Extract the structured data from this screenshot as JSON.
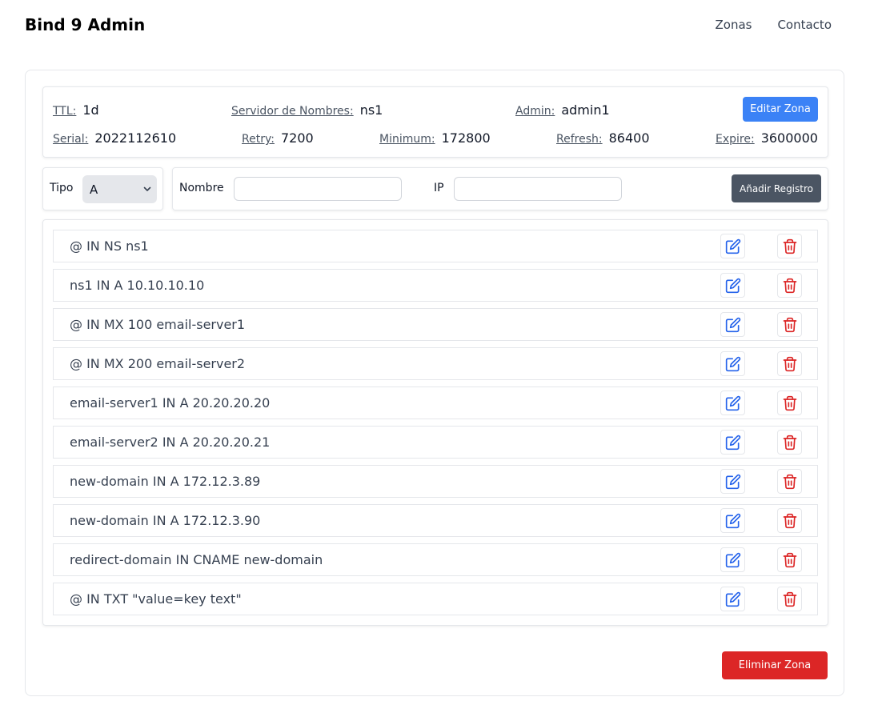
{
  "header": {
    "title": "Bind 9 Admin",
    "nav": [
      {
        "label": "Zonas"
      },
      {
        "label": "Contacto"
      }
    ]
  },
  "zone": {
    "ttl": {
      "label": "TTL:",
      "value": "1d"
    },
    "nameserver": {
      "label": "Servidor de Nombres:",
      "value": "ns1"
    },
    "admin": {
      "label": "Admin:",
      "value": "admin1"
    },
    "serial": {
      "label": "Serial:",
      "value": "2022112610"
    },
    "retry": {
      "label": "Retry:",
      "value": "7200"
    },
    "minimum": {
      "label": "Minimum:",
      "value": "172800"
    },
    "refresh": {
      "label": "Refresh:",
      "value": "86400"
    },
    "expire": {
      "label": "Expire:",
      "value": "3600000"
    },
    "edit_label": "Editar Zona"
  },
  "form": {
    "tipo_label": "Tipo",
    "tipo_value": "A",
    "nombre_label": "Nombre",
    "nombre_value": "",
    "ip_label": "IP",
    "ip_value": "",
    "add_label": "Añadir Registro"
  },
  "records": [
    "@ IN NS ns1",
    "ns1 IN A 10.10.10.10",
    "@ IN MX 100 email-server1",
    "@ IN MX 200 email-server2",
    "email-server1 IN A 20.20.20.20",
    "email-server2 IN A 20.20.20.21",
    "new-domain IN A 172.12.3.89",
    "new-domain IN A 172.12.3.90",
    "redirect-domain IN CNAME new-domain",
    "@ IN TXT \"value=key text\""
  ],
  "icons": {
    "edit": "edit-icon",
    "delete": "trash-icon",
    "select": "chevron-down-icon"
  },
  "colors": {
    "primary": "#3b82f6",
    "secondary": "#4b5563",
    "danger": "#dc2626",
    "edit_icon": "#2563eb",
    "delete_icon": "#dc2626"
  },
  "actions": {
    "delete_zone_label": "Eliminar Zona"
  }
}
